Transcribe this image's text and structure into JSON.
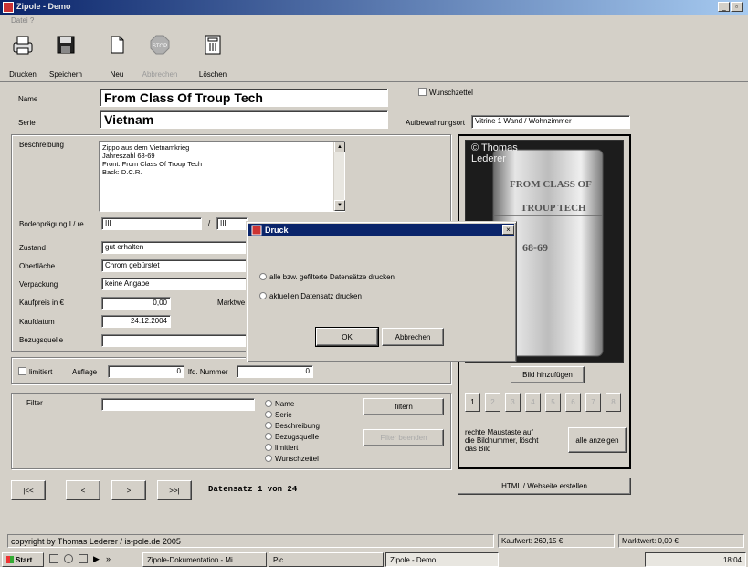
{
  "window": {
    "title": "Zipole - Demo"
  },
  "menu": {
    "file": "Datei ?"
  },
  "toolbar": {
    "print": "Drucken",
    "save": "Speichern",
    "new": "Neu",
    "cancel": "Abbrechen",
    "delete": "Löschen"
  },
  "form": {
    "name_label": "Name",
    "name_value": "From Class Of Troup Tech",
    "series_label": "Serie",
    "series_value": "Vietnam",
    "wishlist_label": "Wunschzettel",
    "storage_label": "Aufbewahrungsort",
    "storage_value": "Vitrine 1 Wand / Wohnzimmer",
    "description_label": "Beschreibung",
    "description_lines": [
      "Zippo aus dem Vietnamkrieg",
      "Jahreszahl 68-69",
      "Front: From Class Of Troup Tech",
      "Back: D.C.R."
    ],
    "bottom_stamp_label": "Bodenprägung I / re",
    "bottom_stamp_left": "III",
    "bottom_stamp_sep": "/",
    "bottom_stamp_right": "III",
    "condition_label": "Zustand",
    "condition_value": "gut erhalten",
    "surface_label": "Oberfläche",
    "surface_value": "Chrom gebürstet",
    "packaging_label": "Verpackung",
    "packaging_value": "keine Angabe",
    "purchase_price_label": "Kaufpreis in €",
    "purchase_price_value": "0,00",
    "market_value_label": "Marktwe",
    "purchase_date_label": "Kaufdatum",
    "purchase_date_value": "24.12.2004",
    "source_label": "Bezugsquelle",
    "source_value": "",
    "limited_label": "limitiert",
    "edition_label": "Auflage",
    "edition_value": "0",
    "serial_label": "lfd. Nummer",
    "serial_value": "0"
  },
  "filter": {
    "label": "Filter",
    "value": "",
    "options": [
      "Name",
      "Serie",
      "Beschreibung",
      "Bezugsquelle",
      "limitiert",
      "Wunschzettel"
    ],
    "filter_button": "filtern",
    "clear_button": "Filter beenden"
  },
  "navigation": {
    "first": "|<<",
    "prev": "<",
    "next": ">",
    "last": ">>|",
    "record_text": "Datensatz 1 von 24"
  },
  "image_panel": {
    "watermark": "© Thomas\nLederer",
    "engraving": [
      "FROM CLASS OF",
      "TROUP TECH",
      "68-69"
    ],
    "add_image_button": "Bild hinzufügen",
    "thumb_numbers": [
      "1",
      "2",
      "3",
      "4",
      "5",
      "6",
      "7",
      "8"
    ],
    "hint": "rechte Maustaste auf\ndie Bildnummer, löscht\ndas Bild",
    "show_all_button": "alle anzeigen",
    "html_button": "HTML / Webseite erstellen"
  },
  "dialog": {
    "title": "Druck",
    "option_all": "alle bzw. gefilterte Datensätze drucken",
    "option_current": "aktuellen Datensatz drucken",
    "ok": "OK",
    "cancel": "Abbrechen"
  },
  "status": {
    "copyright": "copyright by Thomas Lederer / is-pole.de 2005",
    "purchase_value": "Kaufwert: 269,15 €",
    "market_value": "Marktwert: 0,00 €"
  },
  "taskbar": {
    "start": "Start",
    "items": [
      "Zipole-Dokumentation - Mi...",
      "Pic",
      "Zipole - Demo"
    ],
    "clock": "18:04"
  },
  "colors": {
    "title_active": "#0a246a",
    "face": "#d4d0c8"
  }
}
